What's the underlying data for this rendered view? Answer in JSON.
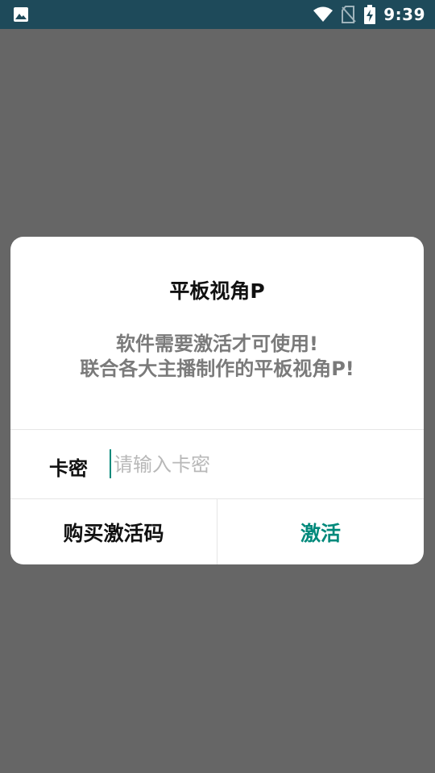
{
  "status_bar": {
    "time": "9:39",
    "icons": [
      "image-icon",
      "wifi-icon",
      "no-sim-icon",
      "battery-charging-icon"
    ]
  },
  "dialog": {
    "title": "平板视角P",
    "message_line1": "软件需要激活才可使用!",
    "message_line2": "联合各大主播制作的平板视角P!",
    "code_label": "卡密",
    "code_value": "",
    "code_placeholder": "请输入卡密",
    "buy_button": "购买激活码",
    "activate_button": "激活"
  },
  "colors": {
    "status_bar_bg": "#1e4a5a",
    "scrim": "#666666",
    "accent": "#00897b"
  }
}
